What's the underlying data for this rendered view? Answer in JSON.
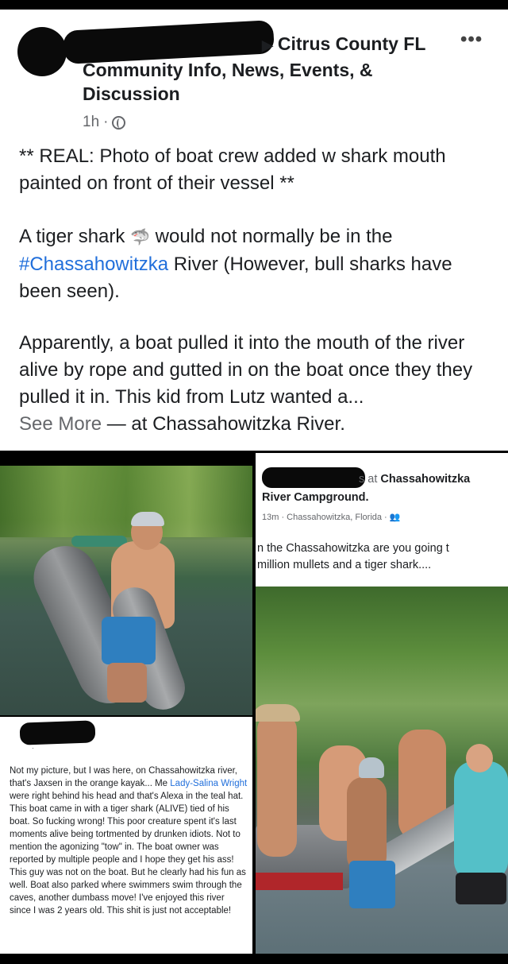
{
  "post": {
    "group_arrow": "▶",
    "group_name": "Citrus County FL",
    "group_line2": "Community Info, News, Events, &",
    "group_line3": "Discussion",
    "more_menu": "•••",
    "time": "1h",
    "dot": "·",
    "p1": "** REAL: Photo of boat crew added w shark mouth painted on front of their vessel **",
    "p2_before": "A tiger shark ",
    "p2_emoji": "🦈",
    "p2_middle": " would not normally be in the ",
    "p2_hashtag": "#Chassahowitzka",
    "p2_after": " River  (However, bull sharks have been seen).",
    "p3": "Apparently, a boat pulled it into the mouth of the river alive by rope and gutted in on the boat once they they pulled it in.  This kid from Lutz wanted a...",
    "see_more": "See More",
    "location_sep": " — at ",
    "location": "Chassahowitzka River."
  },
  "left_comment": {
    "meta": "· ",
    "text_before": "Not my picture, but I was here, on Chassahowitzka river, that's Jaxsen in the orange kayak... Me ",
    "mention": "Lady-Salina Wright",
    "text_after": " were right behind his head and that's Alexa in the teal hat. This boat came in with a tiger shark (ALIVE) tied of his boat. So fucking wrong! This poor creature spent it's last moments alive being tortmented by drunken idiots. Not to mention the agonizing \"tow\" in. The boat owner was reported by multiple people and I hope they get his ass! This guy was not on the boat. But he clearly had his fun as well. Boat also parked where swimmers swim through the caves, another dumbass move! I've enjoyed this river since I was 2 years old. This shit is just not acceptable!"
  },
  "right_post": {
    "hdr_prefix": "s at ",
    "hdr_place": "Chassahowitzka",
    "hdr_line2": "River Campground.",
    "meta": "13m · Chassahowitzka, Florida · 👥",
    "text": "n the Chassahowitzka are you going t\nmillion mullets and a tiger shark...."
  }
}
